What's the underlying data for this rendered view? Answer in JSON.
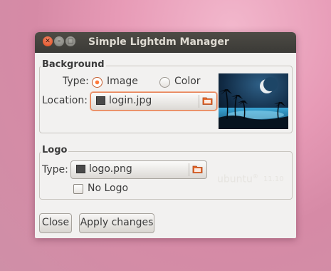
{
  "window": {
    "title": "Simple Lightdm Manager",
    "controls": [
      "close",
      "minimize",
      "maximize"
    ]
  },
  "background": {
    "section_label": "Background",
    "type_label": "Type:",
    "options": [
      {
        "label": "Image",
        "selected": true
      },
      {
        "label": "Color",
        "selected": false
      }
    ],
    "location_label": "Location:",
    "location_value": "login.jpg"
  },
  "logo": {
    "section_label": "Logo",
    "type_label": "Type:",
    "file_value": "logo.png",
    "no_logo_label": "No Logo",
    "no_logo_checked": false,
    "brand_text": "ubuntu",
    "brand_mark": "®",
    "version_text": "11.10"
  },
  "buttons": {
    "close_label": "Close",
    "apply_label": "Apply changes"
  },
  "colors": {
    "accent": "#e05d1e",
    "titlebar": "#3c3b37",
    "window_bg": "#f2f1f0"
  }
}
